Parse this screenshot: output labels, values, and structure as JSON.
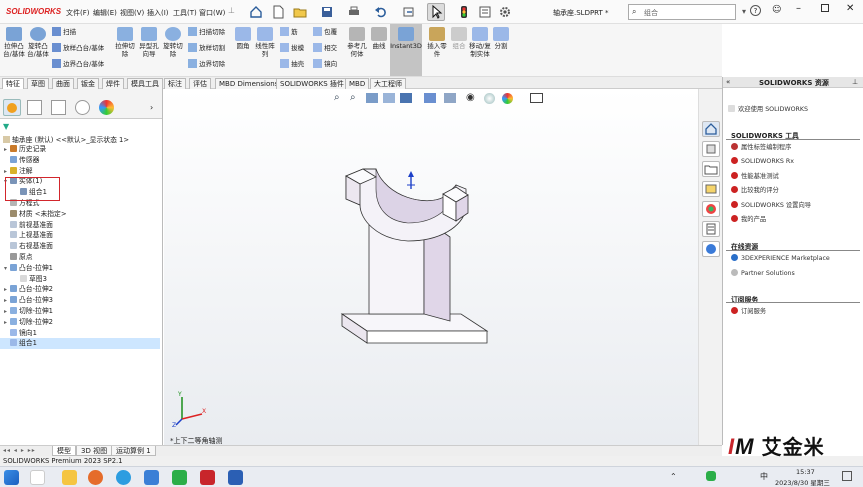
{
  "titlebar": {
    "app_name": "SOLIDWORKS",
    "menus": [
      "文件(F)",
      "编辑(E)",
      "视图(V)",
      "插入(I)",
      "工具(T)",
      "窗口(W)"
    ],
    "document_title": "轴承座.SLDPRT *",
    "search_placeholder": "组合",
    "help": "?"
  },
  "ribbon": {
    "groups": [
      {
        "label": "拉伸凸台/基体"
      },
      {
        "label": "旋转凸台/基体"
      },
      {
        "label": "扫描"
      },
      {
        "label": "放样凸台/基体"
      },
      {
        "label": "边界凸台/基体"
      },
      {
        "label": "拉伸切除"
      },
      {
        "label": "异型孔向导"
      },
      {
        "label": "旋转切除"
      },
      {
        "label": "扫描切除"
      },
      {
        "label": "放样切割"
      },
      {
        "label": "边界切除"
      },
      {
        "label": "圆角"
      },
      {
        "label": "线性阵列"
      },
      {
        "label": "筋"
      },
      {
        "label": "拔模"
      },
      {
        "label": "抽壳"
      },
      {
        "label": "包覆"
      },
      {
        "label": "相交"
      },
      {
        "label": "镜向"
      },
      {
        "label": "参考几何体"
      },
      {
        "label": "曲线"
      },
      {
        "label": "Instant3D"
      },
      {
        "label": "插入零件"
      },
      {
        "label": "组合"
      },
      {
        "label": "移动/复制实体"
      },
      {
        "label": "分割"
      }
    ]
  },
  "command_tabs": [
    "特征",
    "草图",
    "曲面",
    "钣金",
    "焊件",
    "模具工具",
    "标注",
    "评估",
    "MBD Dimensions",
    "SOLIDWORKS 插件",
    "MBD",
    "大工程师"
  ],
  "feature_tree": {
    "root": "轴承座 (默认) <<默认>_显示状态 1>",
    "items": [
      {
        "label": "历史记录",
        "arrow": "▸"
      },
      {
        "label": "传感器",
        "arrow": ""
      },
      {
        "label": "注解",
        "arrow": "▸"
      },
      {
        "label": "实体(1)",
        "arrow": "▾"
      },
      {
        "label": "组合1",
        "arrow": ""
      },
      {
        "label": "方程式",
        "arrow": ""
      },
      {
        "label": "材质 <未指定>",
        "arrow": ""
      },
      {
        "label": "前视基准面",
        "arrow": ""
      },
      {
        "label": "上视基准面",
        "arrow": ""
      },
      {
        "label": "右视基准面",
        "arrow": ""
      },
      {
        "label": "原点",
        "arrow": ""
      },
      {
        "label": "凸台-拉伸1",
        "arrow": "▾"
      },
      {
        "label": "草图3",
        "arrow": ""
      },
      {
        "label": "凸台-拉伸2",
        "arrow": "▸"
      },
      {
        "label": "凸台-拉伸3",
        "arrow": "▸"
      },
      {
        "label": "切除-拉伸1",
        "arrow": "▸"
      },
      {
        "label": "切除-拉伸2",
        "arrow": "▸"
      },
      {
        "label": "镜向1",
        "arrow": ""
      },
      {
        "label": "组合1",
        "arrow": ""
      }
    ]
  },
  "viewport": {
    "view_label": "*上下二等角轴测"
  },
  "task_pane": {
    "title": "SOLIDWORKS 资源",
    "welcome": "欢迎使用 SOLIDWORKS",
    "tools_head": "SOLIDWORKS 工具",
    "tools": [
      "属性标签编制程序",
      "SOLIDWORKS Rx",
      "性能基准测试",
      "比较我的评分",
      "SOLIDWORKS 设置向导",
      "我的产品"
    ],
    "online_head": "在线资源",
    "online": [
      "3DEXPERIENCE Marketplace",
      "Partner Solutions"
    ],
    "sub_head": "订阅服务",
    "sub": [
      "订阅服务"
    ]
  },
  "bottom_tabs": [
    "模型",
    "3D 视图",
    "运动算例 1"
  ],
  "status_bar": {
    "text": "SOLIDWORKS Premium 2023 SP2.1"
  },
  "taskbar": {
    "time": "15:37",
    "date": "2023/8/30 星期三",
    "ime": "中",
    "watermark": "IM 艾金米"
  },
  "colors": {
    "accent_red": "#d2262c",
    "selection_blue": "#cde6ff",
    "part_body": "#f4f2f8",
    "part_shade": "#dcd3e6"
  }
}
